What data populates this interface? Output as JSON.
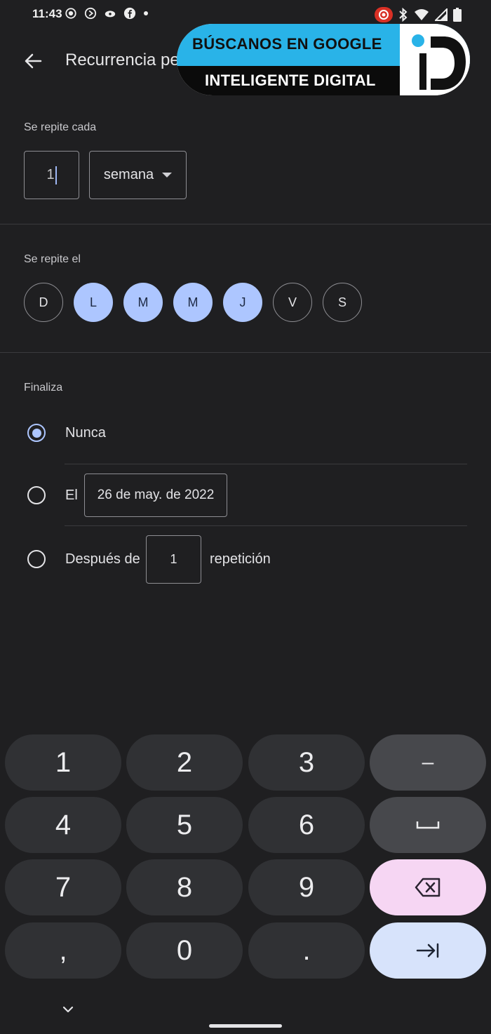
{
  "status_bar": {
    "time": "11:43",
    "left_icons": [
      "screen-record-icon",
      "play-circle-icon",
      "cloud-eye-icon",
      "facebook-icon",
      "dot-icon"
    ],
    "right_icons": [
      "recording-icon",
      "bluetooth-icon",
      "wifi-icon",
      "signal-icon",
      "battery-icon"
    ]
  },
  "app_bar": {
    "back_icon": "arrow-left-icon",
    "title": "Recurrencia pe"
  },
  "watermark": {
    "line1": "BÚSCANOS EN GOOGLE",
    "line2": "INTELIGENTE DIGITAL",
    "logo_letters": "iD",
    "accent": "#29b3e8"
  },
  "repeat_every": {
    "label": "Se repite cada",
    "value": "1",
    "unit": "semana"
  },
  "repeat_on": {
    "label": "Se repite el",
    "days": [
      {
        "letter": "D",
        "selected": false
      },
      {
        "letter": "L",
        "selected": true
      },
      {
        "letter": "M",
        "selected": true
      },
      {
        "letter": "M",
        "selected": true
      },
      {
        "letter": "J",
        "selected": true
      },
      {
        "letter": "V",
        "selected": false
      },
      {
        "letter": "S",
        "selected": false
      }
    ]
  },
  "ends": {
    "label": "Finaliza",
    "never": "Nunca",
    "on_label": "El",
    "on_date": "26 de may. de 2022",
    "after_label": "Después de",
    "after_count": "1",
    "after_unit": "repetición",
    "selected": "never"
  },
  "keyboard": {
    "keys": [
      "1",
      "2",
      "3",
      "–",
      "4",
      "5",
      "6",
      "␣",
      "7",
      "8",
      "9",
      "backspace",
      ",",
      "0",
      ".",
      "next"
    ],
    "collapse_icon": "chevron-down-icon"
  },
  "colors": {
    "background": "#1f1f21",
    "accent": "#adc6ff",
    "key": "#303134",
    "key_dark": "#47484c",
    "backspace_key": "#f6d6f3",
    "next_key": "#d7e3fb"
  }
}
